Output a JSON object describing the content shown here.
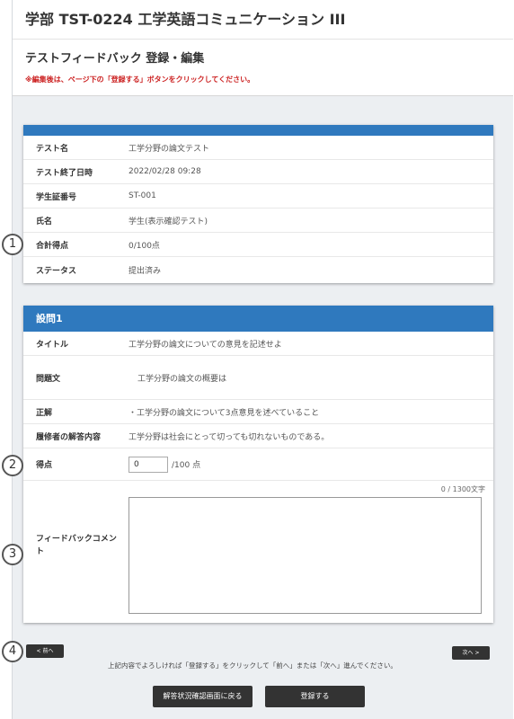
{
  "header": {
    "course_title": "学部 TST-0224 工学英語コミュニケーション III",
    "page_title": "テストフィードバック 登録・編集",
    "notice": "※編集後は、ページ下の「登録する」ボタンをクリックしてください。"
  },
  "test_info": {
    "rows": [
      {
        "label": "テスト名",
        "value": "工学分野の論文テスト"
      },
      {
        "label": "テスト終了日時",
        "value": "2022/02/28 09:28"
      },
      {
        "label": "学生証番号",
        "value": "ST-001"
      },
      {
        "label": "氏名",
        "value": "学生(表示確認テスト)"
      },
      {
        "label": "合計得点",
        "value": "0/100点"
      },
      {
        "label": "ステータス",
        "value": "提出済み"
      }
    ]
  },
  "question": {
    "heading": "設問1",
    "rows": [
      {
        "label": "タイトル",
        "value": "工学分野の論文についての意見を記述せよ"
      },
      {
        "label": "問題文",
        "value": "工学分野の論文の概要は"
      },
      {
        "label": "正解",
        "value": "・工学分野の論文について3点意見を述べていること"
      },
      {
        "label": "履修者の解答内容",
        "value": "工学分野は社会にとって切っても切れないものである。"
      }
    ],
    "score_label": "得点",
    "score_value": "0",
    "score_suffix": "/100 点",
    "feedback_label": "フィードバックコメント",
    "char_count": "0 / 1300文字"
  },
  "navigation": {
    "prev_label": "< 前へ",
    "next_label": "次へ >",
    "guide_text": "上記内容でよろしければ「登録する」をクリックして「前へ」または「次へ」進んでください。",
    "back_button": "解答状況確認画面に戻る",
    "submit_button": "登録する"
  },
  "callouts": [
    "1",
    "2",
    "3",
    "4"
  ]
}
